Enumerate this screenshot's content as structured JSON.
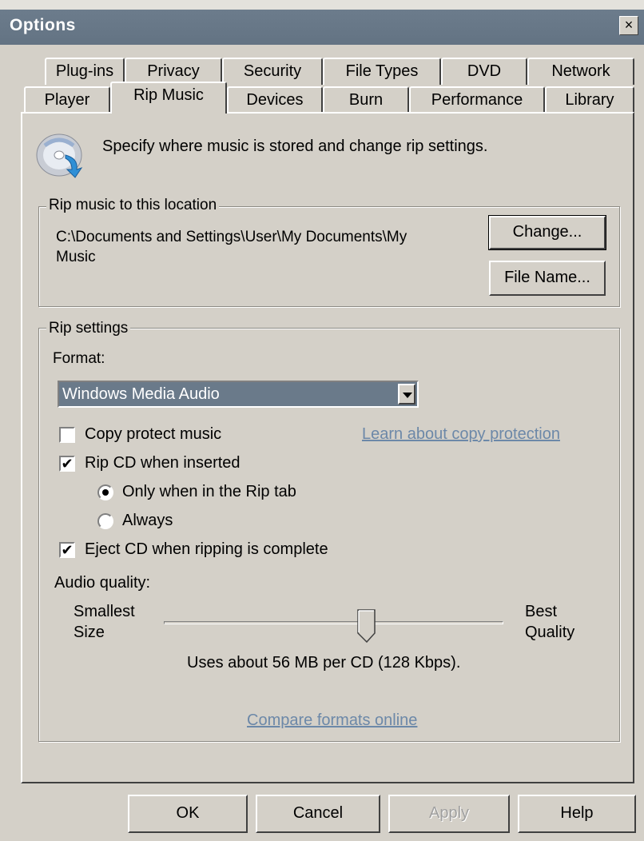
{
  "window": {
    "title": "Options",
    "close_label": "×"
  },
  "tabs_back_row": [
    "Plug-ins",
    "Privacy",
    "Security",
    "File Types",
    "DVD",
    "Network"
  ],
  "tabs_front_row": [
    "Player",
    "Rip Music",
    "Devices",
    "Burn",
    "Performance",
    "Library"
  ],
  "active_tab": "Rip Music",
  "header": {
    "icon": "cd-rip-icon",
    "description": "Specify where music is stored and change rip settings."
  },
  "location_group": {
    "label": "Rip music to this location",
    "path_line1": "C:\\Documents and Settings\\User\\My Documents\\My",
    "path_line2": "Music",
    "change_button": "Change...",
    "filename_button": "File Name..."
  },
  "rip_settings": {
    "label": "Rip settings",
    "format_label": "Format:",
    "format_value": "Windows Media Audio",
    "copy_protect": {
      "label": "Copy protect music",
      "checked": false
    },
    "learn_link": "Learn about copy protection",
    "rip_on_insert": {
      "label": "Rip CD when inserted",
      "checked": true
    },
    "radio_only": {
      "label": "Only when in the Rip tab",
      "selected": true
    },
    "radio_always": {
      "label": "Always",
      "selected": false
    },
    "eject": {
      "label": "Eject CD when ripping is complete",
      "checked": true
    },
    "audio_quality_label": "Audio quality:",
    "smallest_line1": "Smallest",
    "smallest_line2": "Size",
    "best_line1": "Best",
    "best_line2": "Quality",
    "quality_level_fraction": 0.6,
    "usage_text": "Uses about 56 MB per CD (128 Kbps).",
    "compare_link": "Compare formats online"
  },
  "buttons": {
    "ok": "OK",
    "cancel": "Cancel",
    "apply": "Apply",
    "help": "Help"
  },
  "colors": {
    "title_bar": "#637383",
    "face": "#d4d0c8",
    "selection": "#6a7a8a",
    "link": "#6c88a8"
  }
}
